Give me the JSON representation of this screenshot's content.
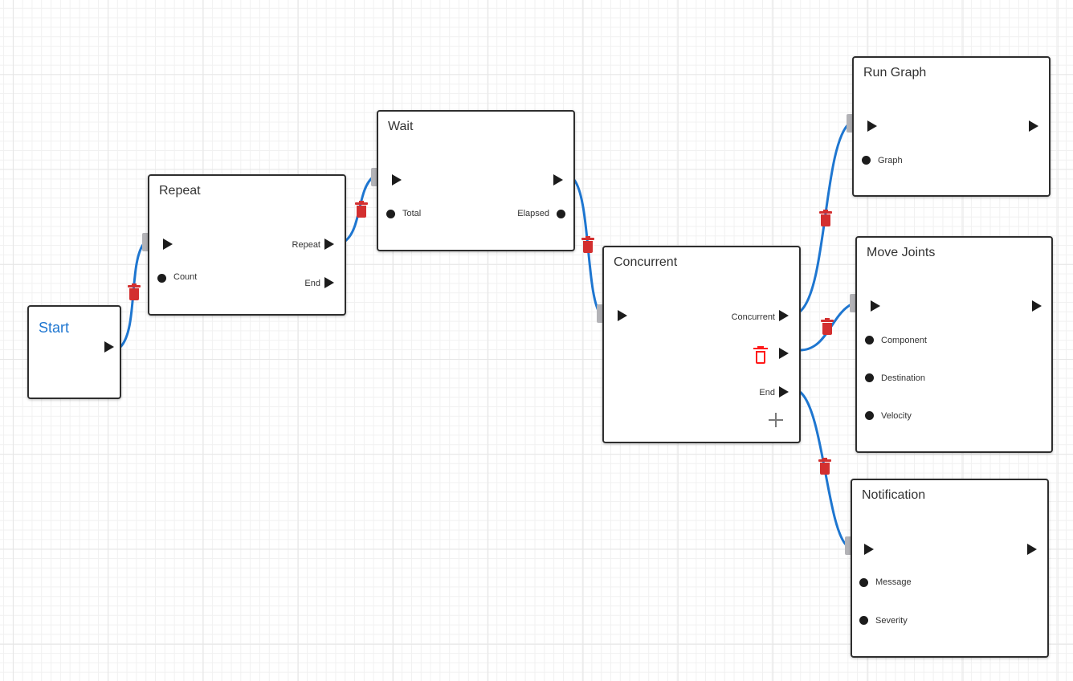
{
  "canvas": {
    "grid": "on",
    "wire_color": "#1e76d0",
    "delete_color": "#d32f2f"
  },
  "nodes": {
    "start": {
      "title": "Start",
      "title_color": "#1e76d0"
    },
    "repeat": {
      "title": "Repeat",
      "inputs": [
        "Count"
      ],
      "outputs": [
        "Repeat",
        "End"
      ]
    },
    "wait": {
      "title": "Wait",
      "inputs": [
        "Total"
      ],
      "outputs": [
        "Elapsed"
      ]
    },
    "concurrent": {
      "title": "Concurrent",
      "outputs": [
        "Concurrent",
        "",
        "End"
      ],
      "add_branch_icon": "plus-icon",
      "remove_branch_icon": "trash-icon"
    },
    "run_graph": {
      "title": "Run Graph",
      "inputs": [
        "Graph"
      ]
    },
    "move_joints": {
      "title": "Move Joints",
      "inputs": [
        "Component",
        "Destination",
        "Velocity"
      ]
    },
    "notification": {
      "title": "Notification",
      "inputs": [
        "Message",
        "Severity"
      ]
    }
  },
  "connections": [
    {
      "from": "Start",
      "from_port": "exec",
      "to": "Repeat",
      "to_port": "exec"
    },
    {
      "from": "Repeat",
      "from_port": "Repeat",
      "to": "Wait",
      "to_port": "exec"
    },
    {
      "from": "Wait",
      "from_port": "exec",
      "to": "Concurrent",
      "to_port": "exec"
    },
    {
      "from": "Concurrent",
      "from_port": "Concurrent",
      "to": "Run Graph",
      "to_port": "exec"
    },
    {
      "from": "Concurrent",
      "from_port": "branch 2",
      "to": "Move Joints",
      "to_port": "exec"
    },
    {
      "from": "Concurrent",
      "from_port": "End",
      "to": "Notification",
      "to_port": "exec"
    }
  ]
}
